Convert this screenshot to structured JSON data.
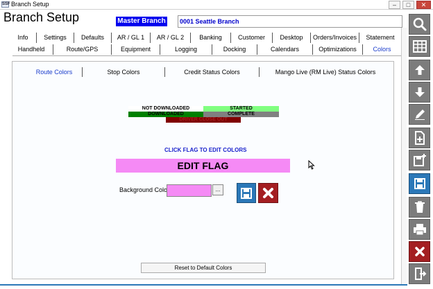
{
  "window": {
    "title": "Branch Setup",
    "icon_text": "SSF",
    "minimize_glyph": "–",
    "maximize_glyph": "□",
    "close_glyph": "✕"
  },
  "header": {
    "app_title": "Branch Setup",
    "branch_badge": "Master Branch",
    "branch_name": "0001  Seattle Branch"
  },
  "tabs_row1": [
    "Info",
    "Settings",
    "Defaults",
    "AR / GL 1",
    "AR / GL 2",
    "Banking",
    "Customer",
    "Desktop",
    "Orders/Invoices",
    "Statement"
  ],
  "tabs_row2": [
    "Handheld",
    "Route/GPS",
    "Equipment",
    "Logging",
    "Docking",
    "Calendars",
    "Optimizations",
    "Colors"
  ],
  "active_tab": "Colors",
  "subtabs": [
    "Route Colors",
    "Stop Colors",
    "Credit Status Colors",
    "Mango Live (RM Live) Status Colors"
  ],
  "active_subtab": "Route Colors",
  "status_flags": [
    {
      "label": "NOT DOWNLOADED",
      "bg": "#ffffff",
      "fg": "#000000"
    },
    {
      "label": "STARTED",
      "bg": "#80ff80",
      "fg": "#000000"
    },
    {
      "label": "DOWNLOADED",
      "bg": "#008000",
      "fg": "#000000"
    },
    {
      "label": "COMPLETE",
      "bg": "#808080",
      "fg": "#000000"
    },
    {
      "label": "DRIVER CLOSE OUT",
      "bg": "#800000",
      "fg": "#a02020"
    }
  ],
  "click_hint": "CLICK FLAG TO EDIT COLORS",
  "edit_flag": {
    "label": "EDIT FLAG",
    "color": "#f58af5"
  },
  "background_color_label": "Background Color",
  "picker_glyph": "...",
  "reset_button": "Reset to Default Colors",
  "toolbar": [
    {
      "icon": "search-icon"
    },
    {
      "icon": "grid-icon"
    },
    {
      "icon": "arrow-up-icon"
    },
    {
      "icon": "arrow-down-icon"
    },
    {
      "icon": "pencil-icon"
    },
    {
      "icon": "new-document-icon"
    },
    {
      "icon": "save-new-icon"
    },
    {
      "icon": "save-icon"
    },
    {
      "icon": "trash-icon"
    },
    {
      "icon": "print-icon"
    },
    {
      "icon": "close-icon"
    },
    {
      "icon": "exit-icon"
    }
  ],
  "colors": {
    "accent_blue": "#2b78b8",
    "active_tab_text": "#1a3ccc",
    "cancel_red": "#a41f22"
  }
}
